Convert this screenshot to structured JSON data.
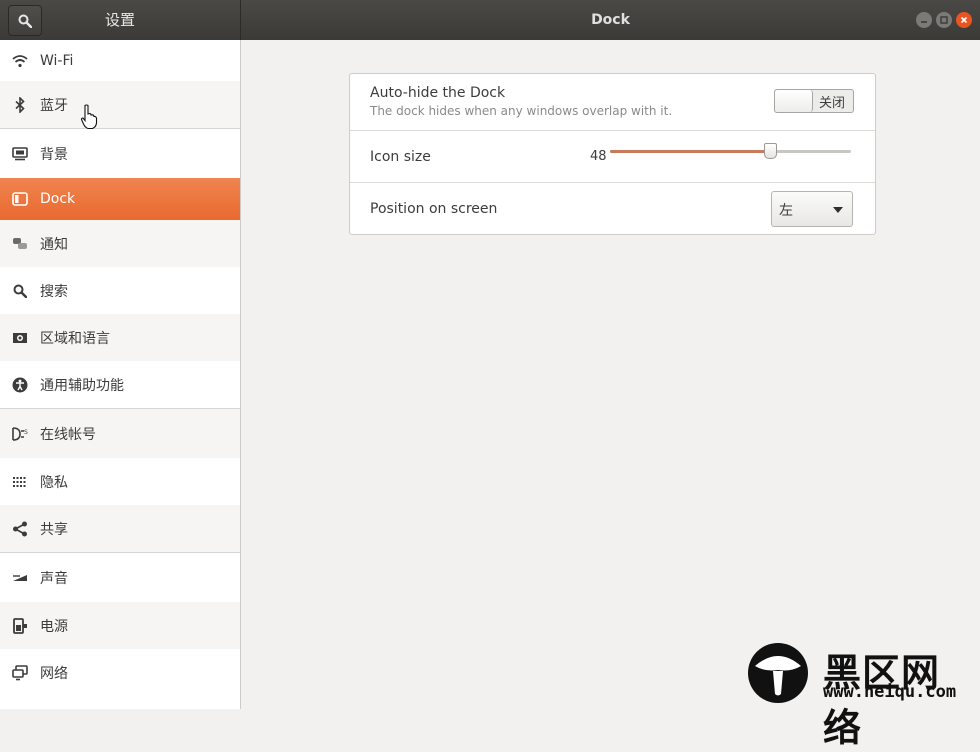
{
  "header": {
    "settings_title": "设置",
    "window_title": "Dock"
  },
  "sidebar": {
    "active_color": "#e95420",
    "items": [
      {
        "label": "Wi-Fi",
        "icon": "wifi-icon"
      },
      {
        "label": "蓝牙",
        "icon": "bluetooth-icon"
      },
      {
        "label": "背景",
        "icon": "background-icon"
      },
      {
        "label": "Dock",
        "icon": "dock-icon",
        "active": true
      },
      {
        "label": "通知",
        "icon": "notifications-icon"
      },
      {
        "label": "搜索",
        "icon": "search-icon"
      },
      {
        "label": "区域和语言",
        "icon": "region-icon"
      },
      {
        "label": "通用辅助功能",
        "icon": "accessibility-icon"
      },
      {
        "label": "在线帐号",
        "icon": "online-accounts-icon"
      },
      {
        "label": "隐私",
        "icon": "privacy-icon"
      },
      {
        "label": "共享",
        "icon": "share-icon"
      },
      {
        "label": "声音",
        "icon": "sound-icon"
      },
      {
        "label": "电源",
        "icon": "power-icon"
      },
      {
        "label": "网络",
        "icon": "network-icon"
      }
    ]
  },
  "dock": {
    "autohide": {
      "title": "Auto-hide the Dock",
      "subtitle": "The dock hides when any windows overlap with it.",
      "state_label": "关闭",
      "enabled": false
    },
    "icon_size": {
      "title": "Icon size",
      "value": "48",
      "fraction": 0.66
    },
    "position": {
      "title": "Position on screen",
      "value": "左"
    }
  },
  "watermark": {
    "text": "黑区网络",
    "url": "www.heiqu.com"
  }
}
